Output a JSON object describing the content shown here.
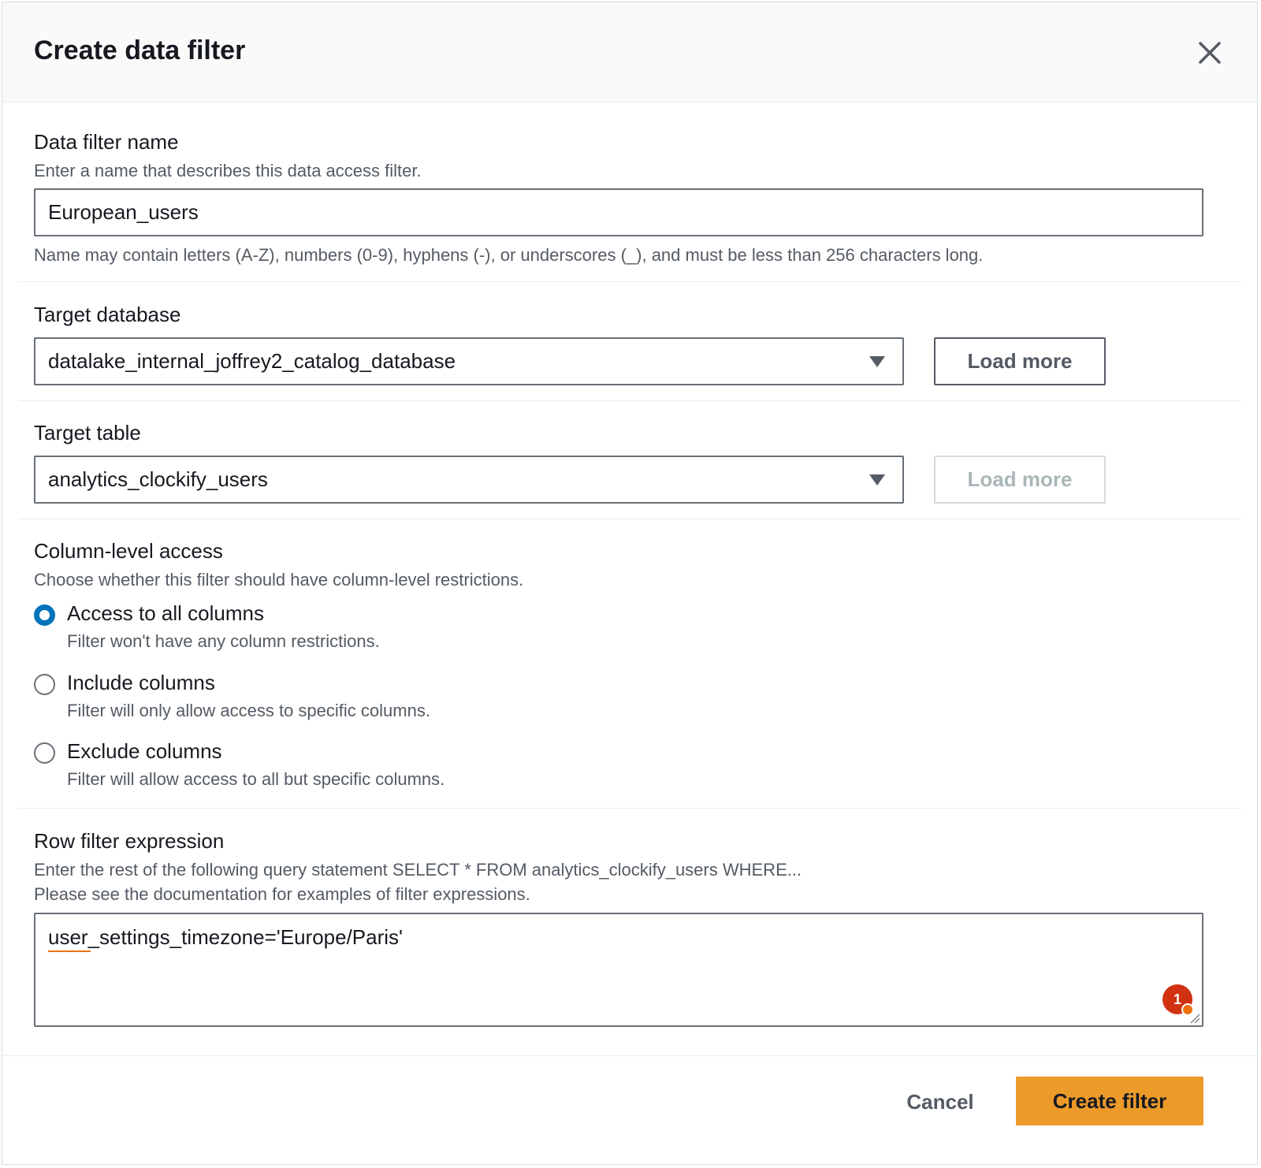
{
  "modal": {
    "title": "Create data filter",
    "close_icon": "close-icon"
  },
  "filter_name": {
    "label": "Data filter name",
    "description": "Enter a name that describes this data access filter.",
    "value": "European_users",
    "constraint": "Name may contain letters (A-Z), numbers (0-9), hyphens (-), or underscores (_), and must be less than 256 characters long."
  },
  "target_database": {
    "label": "Target database",
    "selected": "datalake_internal_joffrey2_catalog_database",
    "load_more_label": "Load more"
  },
  "target_table": {
    "label": "Target table",
    "selected": "analytics_clockify_users",
    "load_more_label": "Load more"
  },
  "column_access": {
    "label": "Column-level access",
    "description": "Choose whether this filter should have column-level restrictions.",
    "options": [
      {
        "label": "Access to all columns",
        "description": "Filter won't have any column restrictions.",
        "checked": true
      },
      {
        "label": "Include columns",
        "description": "Filter will only allow access to specific columns.",
        "checked": false
      },
      {
        "label": "Exclude columns",
        "description": "Filter will allow access to all but specific columns.",
        "checked": false
      }
    ]
  },
  "row_filter": {
    "label": "Row filter expression",
    "description_1": "Enter the rest of the following query statement SELECT * FROM analytics_clockify_users WHERE...",
    "description_2": "Please see the documentation for examples of filter expressions.",
    "value": "user_settings_timezone='Europe/Paris'",
    "badge_count": "1"
  },
  "footer": {
    "cancel_label": "Cancel",
    "create_label": "Create filter"
  },
  "colors": {
    "primary_button": "#ec9a2a",
    "radio_checked": "#0073bb",
    "badge": "#d13212"
  }
}
